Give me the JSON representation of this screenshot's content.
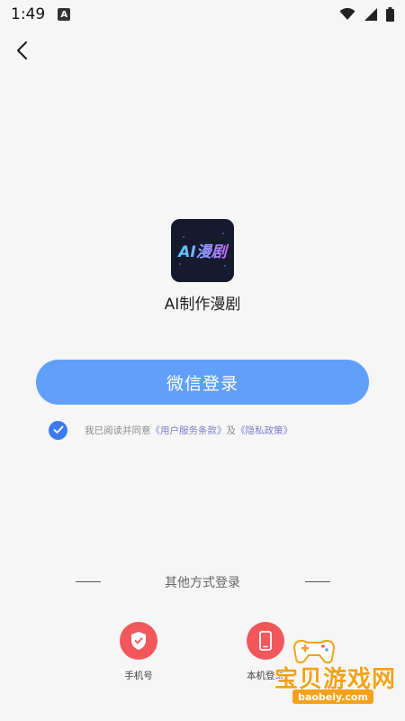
{
  "status_bar": {
    "time": "1:49",
    "notification_badge": "A"
  },
  "app": {
    "icon_text": "AI漫剧",
    "name": "AI制作漫剧"
  },
  "login": {
    "wechat_label": "微信登录"
  },
  "agreement": {
    "prefix": "我已阅读并同意",
    "terms": "《用户服务条款》",
    "conjunction": "及",
    "privacy": "《隐私政策》",
    "checked": true
  },
  "other_methods": {
    "title": "其他方式登录",
    "options": [
      {
        "label": "手机号",
        "icon": "shield-icon"
      },
      {
        "label": "本机登录",
        "icon": "phone-icon"
      }
    ]
  },
  "watermark": {
    "title": "宝贝游戏网",
    "url": "baobeiy.com"
  },
  "colors": {
    "background": "#f6f6f6",
    "primary_button": "#60a0fb",
    "checkbox": "#3c7af2",
    "link": "#7b7fcc",
    "option_circle": "#f1575b",
    "watermark": "#f5a21a"
  }
}
